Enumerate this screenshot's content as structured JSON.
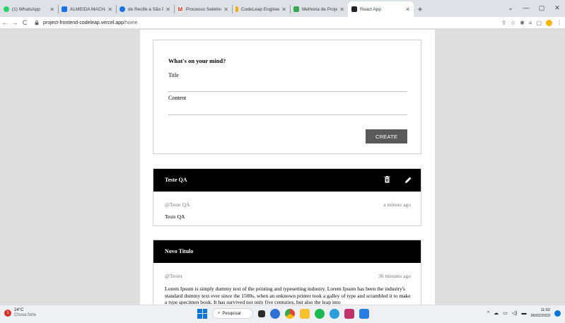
{
  "browser": {
    "tabs": [
      {
        "title": "(1) WhatsApp",
        "icon": "whatsapp-icon",
        "color": "#25d366",
        "active": false
      },
      {
        "title": "ALMEIDA MACHADO",
        "icon": "document-icon",
        "color": "#1a73e8",
        "active": false
      },
      {
        "title": "de Recife a São Paulo",
        "icon": "globe-icon",
        "color": "#1a73e8",
        "active": false
      },
      {
        "title": "Processo Seletivo Co",
        "icon": "gmail-icon",
        "color": "#d93025",
        "active": false
      },
      {
        "title": "CodeLeap Engineerin",
        "icon": "codeleap-icon",
        "color": "#f9ab00",
        "active": false
      },
      {
        "title": "Melhoria de Projeto",
        "icon": "sheet-icon",
        "color": "#34a853",
        "active": false
      },
      {
        "title": "React App",
        "icon": "react-icon",
        "color": "#20232a",
        "active": true
      }
    ],
    "new_tab": "+",
    "window_controls": [
      "⌄",
      "—",
      "▢",
      "✕"
    ],
    "nav": {
      "back": "←",
      "forward": "→",
      "reload": "C"
    },
    "url": {
      "host": "project-frontend-codeleap.vercel.app",
      "path": "/home"
    }
  },
  "form": {
    "heading": "What's on your mind?",
    "title_label": "Title",
    "content_label": "Content",
    "create_label": "CREATE"
  },
  "posts": [
    {
      "title": "Teste QA",
      "author": "@Teste QA",
      "time": "a minute ago",
      "content": "Teste QA",
      "editable": true
    },
    {
      "title": "Novo Titulo",
      "author": "@Tester",
      "time": "36 minutes ago",
      "content": "Lorem Ipsum is simply dummy text of the printing and typesetting industry. Lorem Ipsum has been the industry's standard dummy text ever since the 1500s, when an unknown printer took a galley of type and scrambled it to make a type specimen book. It has survived not only five centuries, but also the leap into",
      "editable": false
    }
  ],
  "taskbar": {
    "weather_badge": "1",
    "temperature": "24°C",
    "weather_text": "Chuva forte",
    "search_label": "Pesquisar",
    "time": "11:02",
    "date": "06/02/2023",
    "tray": "^"
  },
  "colors": {
    "page_bg": "#dedede",
    "header_bg": "#000000",
    "button_bg": "#5a5a5a",
    "muted_text": "#7b7b7b"
  }
}
